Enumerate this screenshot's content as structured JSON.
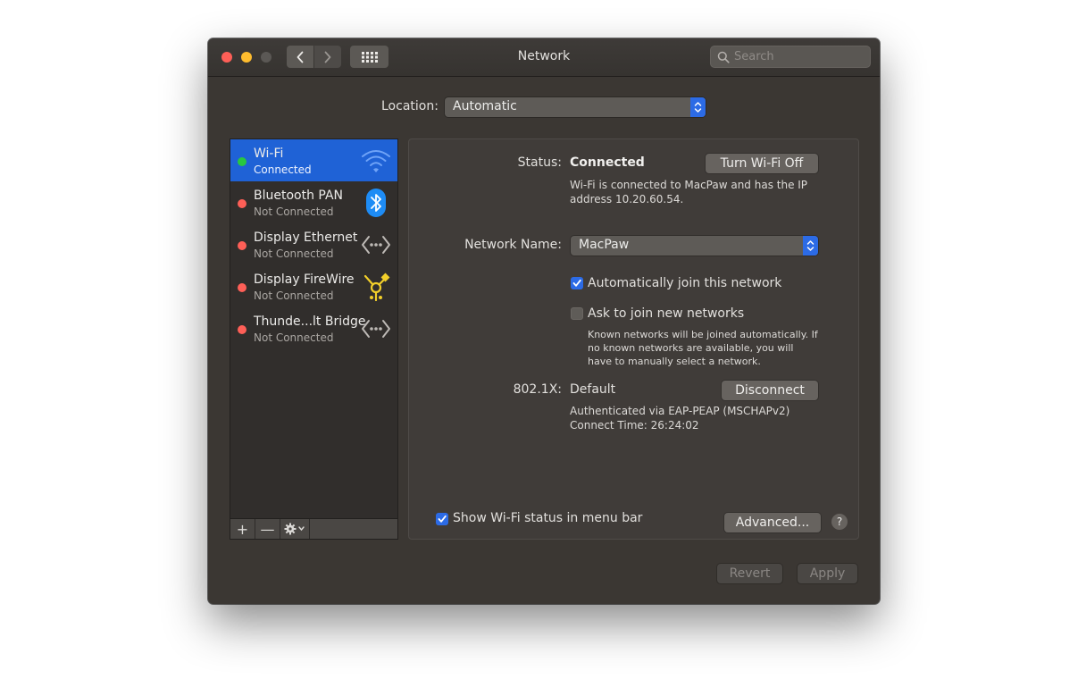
{
  "window": {
    "title": "Network",
    "search": {
      "placeholder": "Search",
      "value": ""
    }
  },
  "location": {
    "label": "Location:",
    "value": "Automatic"
  },
  "services": [
    {
      "name": "Wi-Fi",
      "status": "Connected",
      "status_color": "#28c840",
      "icon": "wifi-icon",
      "selected": true
    },
    {
      "name": "Bluetooth PAN",
      "status": "Not Connected",
      "status_color": "#fe5f57",
      "icon": "bluetooth-icon",
      "selected": false
    },
    {
      "name": "Display Ethernet",
      "status": "Not Connected",
      "status_color": "#fe5f57",
      "icon": "ethernet-arrows-icon",
      "selected": false
    },
    {
      "name": "Display FireWire",
      "status": "Not Connected",
      "status_color": "#fe5f57",
      "icon": "firewire-icon",
      "selected": false
    },
    {
      "name": "Thunde...lt Bridge",
      "status": "Not Connected",
      "status_color": "#fe5f57",
      "icon": "ethernet-arrows-icon",
      "selected": false
    }
  ],
  "sidebar_toolbar": {
    "add": "+",
    "remove": "—"
  },
  "detail": {
    "status_label": "Status:",
    "status_value": "Connected",
    "wifi_toggle_button": "Turn Wi-Fi Off",
    "status_description": "Wi-Fi is connected to MacPaw and has the IP address 10.20.60.54.",
    "network_name_label": "Network Name:",
    "network_name_value": "MacPaw",
    "auto_join": {
      "label": "Automatically join this network",
      "checked": true
    },
    "ask_join": {
      "label": "Ask to join new networks",
      "checked": false
    },
    "ask_join_description": "Known networks will be joined automatically. If no known networks are available, you will have to manually select a network.",
    "dot1x_label": "802.1X:",
    "dot1x_value": "Default",
    "disconnect_button": "Disconnect",
    "auth_line": "Authenticated via EAP-PEAP (MSCHAPv2)",
    "connect_time": "Connect Time: 26:24:02",
    "show_status": {
      "label": "Show Wi-Fi status in menu bar",
      "checked": true
    },
    "advanced_button": "Advanced...",
    "help": "?"
  },
  "footer": {
    "revert": "Revert",
    "apply": "Apply"
  },
  "colors": {
    "accent": "#2c6be6",
    "selected_row": "#1f62d6",
    "connected": "#28c840",
    "disconnected": "#fe5f57"
  }
}
